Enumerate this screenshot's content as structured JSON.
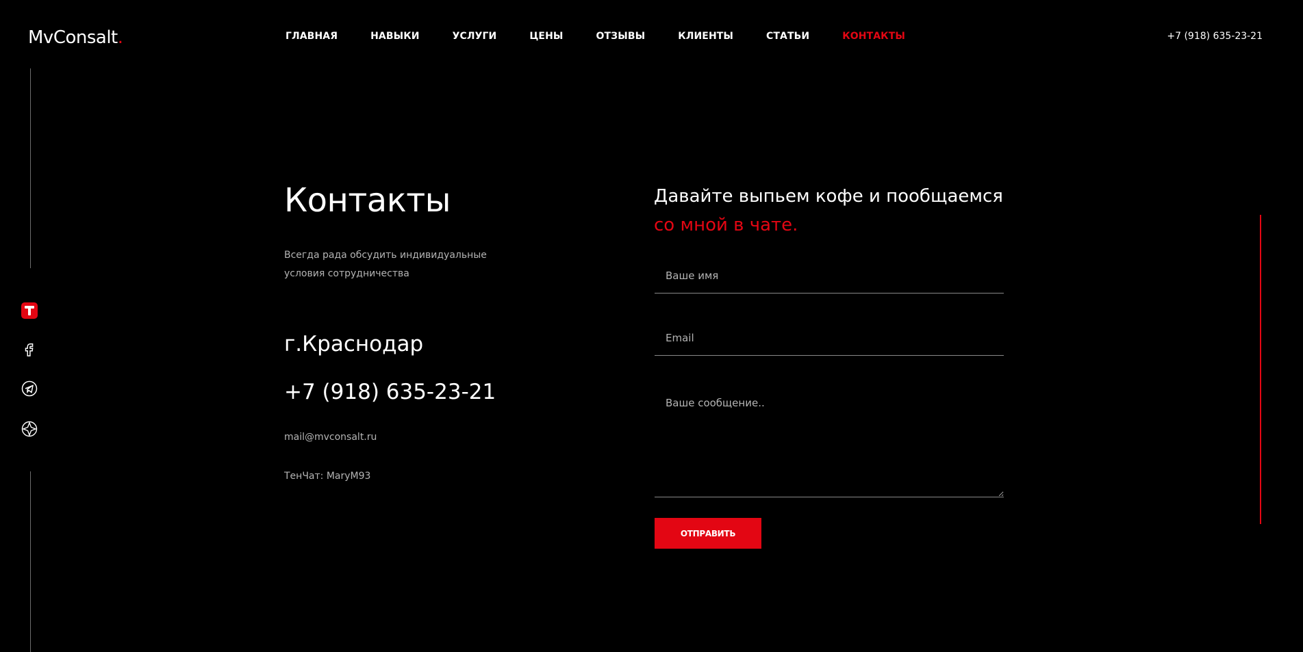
{
  "header": {
    "logo_text": "MvConsalt",
    "logo_dot": ".",
    "phone": "+7 (918) 635-23-21",
    "nav": [
      {
        "label": "ГЛАВНАЯ"
      },
      {
        "label": "НАВЫКИ"
      },
      {
        "label": "УСЛУГИ"
      },
      {
        "label": "ЦЕНЫ"
      },
      {
        "label": "ОТЗЫВЫ"
      },
      {
        "label": "КЛИЕНТЫ"
      },
      {
        "label": "СТАТЬИ"
      },
      {
        "label": "КОНТАКТЫ",
        "active": true
      }
    ]
  },
  "social": [
    "tenchat-icon",
    "facebook-icon",
    "telegram-icon",
    "compass-icon"
  ],
  "contacts": {
    "title": "Контакты",
    "description": "Всегда рада обсудить индивидуальные условия сотрудничества",
    "city": "г.Краснодар",
    "phone": "+7 (918) 635-23-21",
    "email": "mail@mvconsalt.ru",
    "tenchat": "ТенЧат: MaryM93"
  },
  "form": {
    "title_line1": "Давайте выпьем кофе и пообщаемся",
    "title_line2": "со мной в чате.",
    "name_placeholder": "Ваше имя",
    "email_placeholder": "Email",
    "message_placeholder": "Ваше сообщение..",
    "submit_label": "ОТПРАВИТЬ"
  },
  "colors": {
    "accent": "#e30613",
    "background": "#000000",
    "muted_text": "#b4b4b4"
  }
}
